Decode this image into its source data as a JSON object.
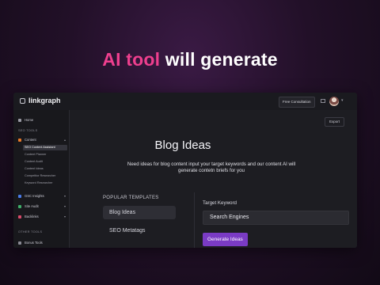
{
  "headline": {
    "accent": "AI tool",
    "rest": " will generate"
  },
  "topbar": {
    "logo": "linkgraph",
    "consultation": "Free Consultation"
  },
  "sidebar": {
    "home": "Home",
    "seo_tools": "SEO TOOLS",
    "content": "Content",
    "content_items": [
      "SEO Content Assistant",
      "Content Planner",
      "Content Audit",
      "Content Ideas",
      "Competitor Researcher",
      "Keyword Researcher"
    ],
    "gsc_insights": "GSC Insights",
    "site_audit": "Site Audit",
    "backlinks": "Backlinks",
    "other_tools": "OTHER TOOLS",
    "bonus_tools": "Bonus Tools"
  },
  "main": {
    "export": "Export",
    "title": "Blog Ideas",
    "description": "Need ideas for blog content input your target keywords and our content AI will generate contetn briefs for you",
    "templates_label": "POPULAR TEMPLATES",
    "templates": [
      "Blog Ideas",
      "SEO Metatags"
    ],
    "keyword_label": "Target Keyword",
    "keyword_value": "Search Engines",
    "generate": "Generate Ideas"
  },
  "colors": {
    "accent": "#ee3f8e",
    "button": "#7a3bc4"
  }
}
